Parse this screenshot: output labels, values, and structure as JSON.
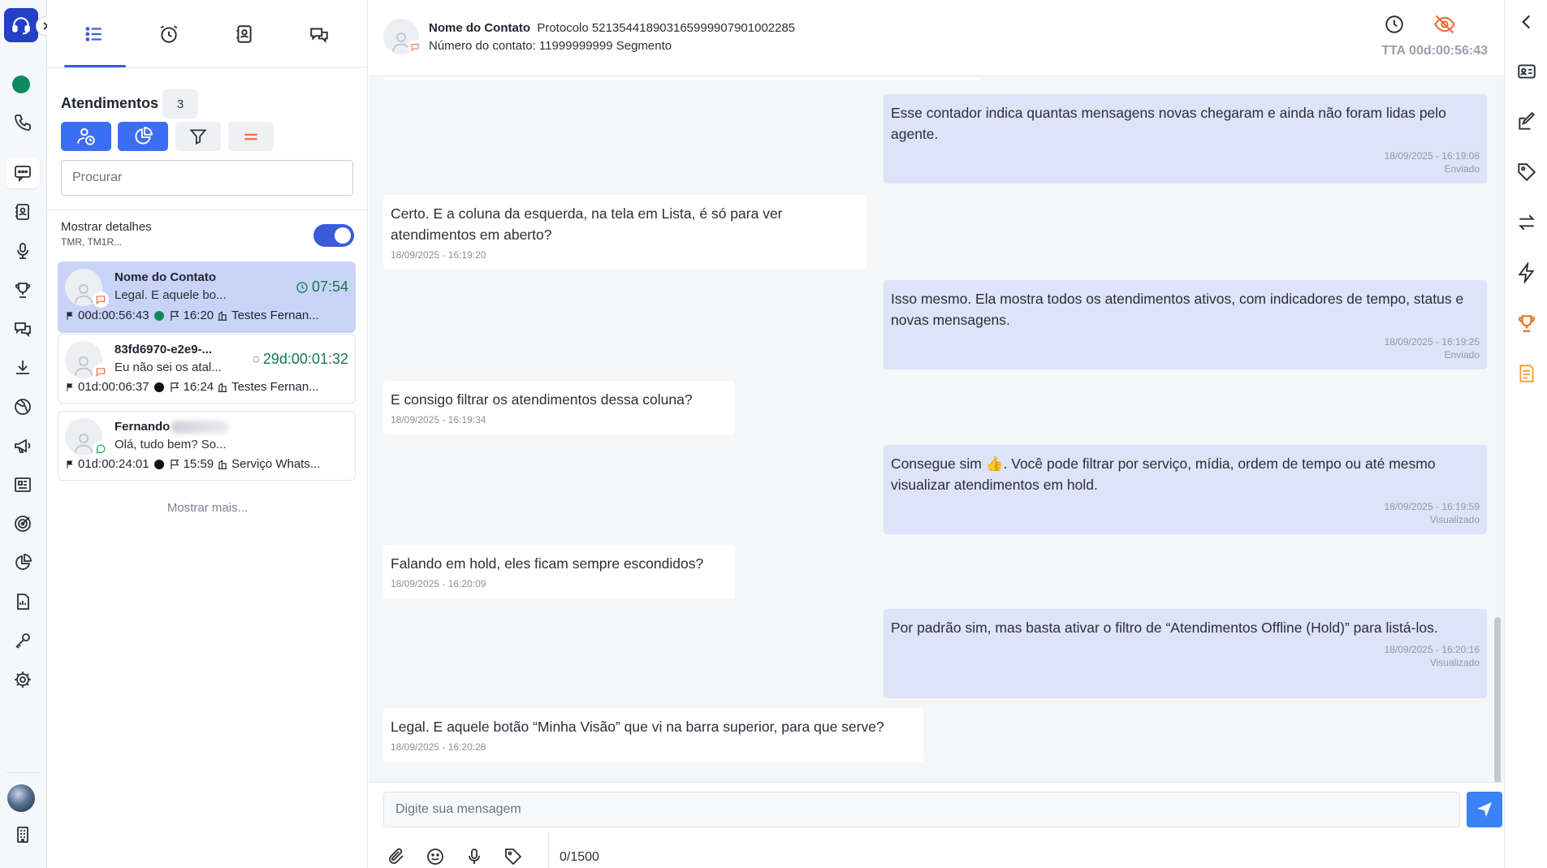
{
  "rail": {
    "items": [
      {
        "name": "phone-icon"
      },
      {
        "name": "chat-icon"
      },
      {
        "name": "contacts-icon"
      },
      {
        "name": "microphone-icon"
      },
      {
        "name": "trophy-icon"
      },
      {
        "name": "conversations-icon"
      },
      {
        "name": "download-icon"
      },
      {
        "name": "globe-icon"
      },
      {
        "name": "megaphone-icon"
      },
      {
        "name": "newspaper-icon"
      },
      {
        "name": "target-icon"
      },
      {
        "name": "pie-chart-icon"
      },
      {
        "name": "report-icon"
      },
      {
        "name": "key-icon"
      },
      {
        "name": "settings-icon"
      },
      {
        "name": "building-icon"
      }
    ],
    "status_color": "#0f8a5f",
    "brand_color": "#2440c4"
  },
  "list": {
    "tabs": [
      "list-icon",
      "alarm-clock-icon",
      "contact-card-icon",
      "chat-bubbles-icon"
    ],
    "title": "Atendimentos",
    "count": "3",
    "search_placeholder": "Procurar",
    "details_label": "Mostrar detalhes",
    "details_sub": "TMR, TM1R...",
    "details_enabled": true,
    "cards": [
      {
        "name": "Nome do Contato",
        "preview": "Legal. E aquele bo...",
        "timer": "07:54",
        "duration": "00d:00:56:43",
        "dot_color": "#0f8a5f",
        "time": "16:20",
        "service": "Testes Fernan...",
        "channel": "chat",
        "active": true
      },
      {
        "name": "83fd6970-e2e9-...",
        "preview": "Eu não sei os atal...",
        "timer": "29d:00:01:32",
        "duration": "01d:00:06:37",
        "dot_color": "#111111",
        "time": "16:24",
        "service": "Testes Fernan...",
        "channel": "chat",
        "active": false
      },
      {
        "name": "Fernando",
        "preview": "Olá, tudo bem? So...",
        "timer": "",
        "duration": "01d:00:24:01",
        "dot_color": "#111111",
        "time": "15:59",
        "service": "Serviço Whats...",
        "channel": "whatsapp",
        "active": false
      }
    ],
    "show_more": "Mostrar mais..."
  },
  "chat": {
    "contact_name": "Nome do Contato",
    "protocol": "Protocolo 5213544189031659999079010022 85",
    "protocol_text": "Protocolo 52135441890316599990790100228 5",
    "line1_rest": "Protocolo 521354418903165999907901002285",
    "line2": "Número do contato: 11999999999 Segmento",
    "tta": "TTA 00d:00:56:43",
    "messages": [
      {
        "dir": "out",
        "text": "Esse contador indica quantas mensagens novas chegaram e ainda não foram lidas pelo agente.",
        "time": "18/09/2025 - 16:19:08",
        "status": "Enviado"
      },
      {
        "dir": "in",
        "text": "Certo. E a coluna da esquerda, na tela em Lista, é só para ver atendimentos em aberto?",
        "time": "18/09/2025 - 16:19:20"
      },
      {
        "dir": "out",
        "text": "Isso mesmo. Ela mostra todos os atendimentos ativos, com indicadores de tempo, status e novas mensagens.",
        "time": "18/09/2025 - 16:19:25",
        "status": "Enviado"
      },
      {
        "dir": "in",
        "text": "E consigo filtrar os atendimentos dessa coluna?",
        "time": "18/09/2025 - 16:19:34"
      },
      {
        "dir": "out",
        "text": "Consegue sim 👍. Você pode filtrar por serviço, mídia, ordem de tempo ou até mesmo visualizar atendimentos em hold.",
        "time": "18/09/2025 - 16:19:59",
        "status": "Visualizado"
      },
      {
        "dir": "in",
        "text": "Falando em hold, eles ficam sempre escondidos?",
        "time": "18/09/2025 - 16:20:09"
      },
      {
        "dir": "out",
        "text": "Por padrão sim, mas basta ativar o filtro de “Atendimentos Offline (Hold)” para listá-los.",
        "time": "18/09/2025 - 16:20:16",
        "status": "Visualizado"
      },
      {
        "dir": "in",
        "text": "Legal. E aquele botão “Minha Visão” que vi na barra superior, para que serve?",
        "time": "18/09/2025 - 16:20:28"
      }
    ],
    "composer": {
      "placeholder": "Digite sua mensagem",
      "counter": "0/1500"
    }
  },
  "right_rail": [
    "chevron-left-icon",
    "id-card-icon",
    "edit-note-icon",
    "tag-icon",
    "transfer-icon",
    "lightning-icon",
    "trophy-icon",
    "notes-icon"
  ]
}
